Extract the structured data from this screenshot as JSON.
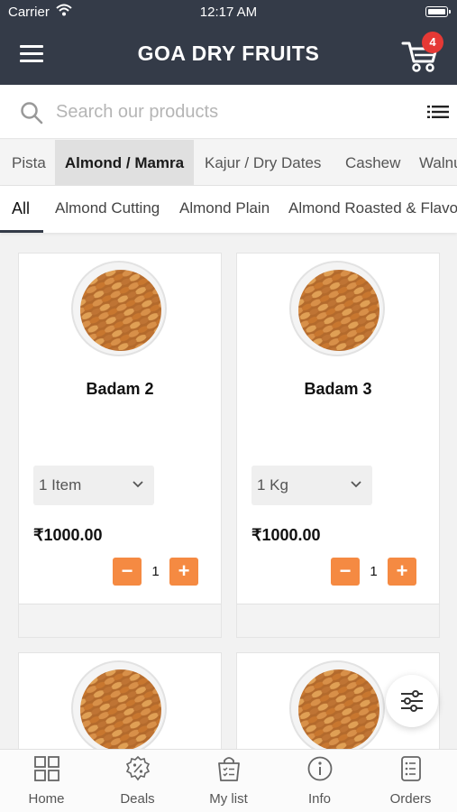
{
  "status_bar": {
    "carrier": "Carrier",
    "time": "12:17 AM"
  },
  "header": {
    "title": "GOA DRY FRUITS",
    "cart_count": "4"
  },
  "search": {
    "placeholder": "Search our products"
  },
  "category_tabs": [
    "Pista",
    "Almond / Mamra",
    "Kajur / Dry Dates",
    "Cashew",
    "Walnut"
  ],
  "active_category": "Almond / Mamra",
  "sub_tabs": [
    "All",
    "Almond Cutting",
    "Almond Plain",
    "Almond Roasted & Flavoured"
  ],
  "active_sub_tab": "All",
  "products": [
    {
      "name": "Badam 2",
      "variant": "1 Item",
      "price": "₹1000.00",
      "quantity": "1"
    },
    {
      "name": "Badam 3",
      "variant": "1 Kg",
      "price": "₹1000.00",
      "quantity": "1"
    }
  ],
  "qty_controls": {
    "minus": "−",
    "plus": "+"
  },
  "bottom_nav": [
    {
      "label": "Home",
      "icon": "grid-icon"
    },
    {
      "label": "Deals",
      "icon": "discount-badge-icon"
    },
    {
      "label": "My list",
      "icon": "shopping-bag-list-icon"
    },
    {
      "label": "Info",
      "icon": "info-icon"
    },
    {
      "label": "Orders",
      "icon": "orders-icon"
    }
  ],
  "colors": {
    "header_bg": "#343b48",
    "accent": "#f58a42",
    "badge": "#e53935"
  }
}
